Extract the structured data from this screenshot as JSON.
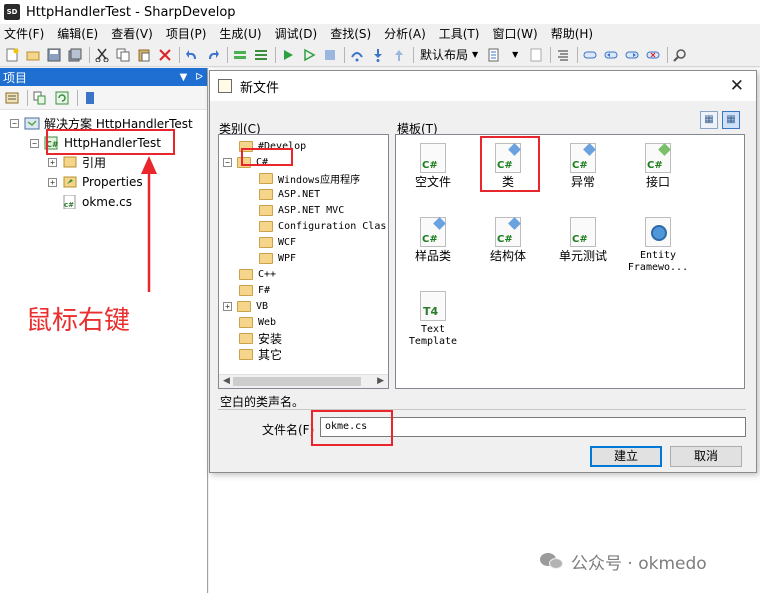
{
  "window": {
    "app_icon": "SD",
    "title": "HttpHandlerTest - SharpDevelop"
  },
  "menu": [
    "文件(F)",
    "编辑(E)",
    "查看(V)",
    "项目(P)",
    "生成(U)",
    "调试(D)",
    "查找(S)",
    "分析(A)",
    "工具(T)",
    "窗口(W)",
    "帮助(H)"
  ],
  "toolbar": {
    "layout_label": "默认布局",
    "icons": [
      "new-file-icon",
      "open-icon",
      "save-icon",
      "save-all-icon",
      "cut-icon",
      "copy-icon",
      "paste-icon",
      "delete-icon",
      "undo-icon",
      "redo-icon",
      "build-icon",
      "run-icon",
      "run-without-debug-icon",
      "stop-icon",
      "step-over-icon",
      "step-into-icon",
      "step-out-icon"
    ]
  },
  "project_pad": {
    "title": "项目",
    "tree": {
      "solution": "解决方案 HttpHandlerTest",
      "project": "HttpHandlerTest",
      "references": "引用",
      "properties": "Properties",
      "file": "okme.cs"
    }
  },
  "annotation": "鼠标右键",
  "dialog": {
    "title": "新文件",
    "category_label": "类别(C)",
    "template_label": "模板(T)",
    "categories": {
      "develop": "#Develop",
      "csharp": "C#",
      "csharp_children": [
        "Windows应用程序",
        "ASP.NET",
        "ASP.NET MVC",
        "Configuration Clas",
        "WCF",
        "WPF"
      ],
      "others": [
        "C++",
        "F#",
        "VB",
        "Web",
        "安装",
        "其它"
      ]
    },
    "templates": {
      "empty_file": "空文件",
      "class": "类",
      "exception": "异常",
      "interface": "接口",
      "sample_class": "样品类",
      "struct": "结构体",
      "unit_test": "单元测试",
      "entity_line1": "Entity",
      "entity_line2": "Framewo...",
      "text_template_line1": "Text",
      "text_template_line2": "Template",
      "cs_badge": "C#",
      "t4_badge": "T4"
    },
    "description": "空白的类声名。",
    "filename_label": "文件名(F)",
    "filename_value": "okme.cs",
    "ok_label": "建立",
    "cancel_label": "取消"
  },
  "watermark": "公众号 · okmedo",
  "colors": {
    "accent": "#0078d7",
    "annotation_red": "#e8262b",
    "pad_header": "#1e6fd1"
  }
}
